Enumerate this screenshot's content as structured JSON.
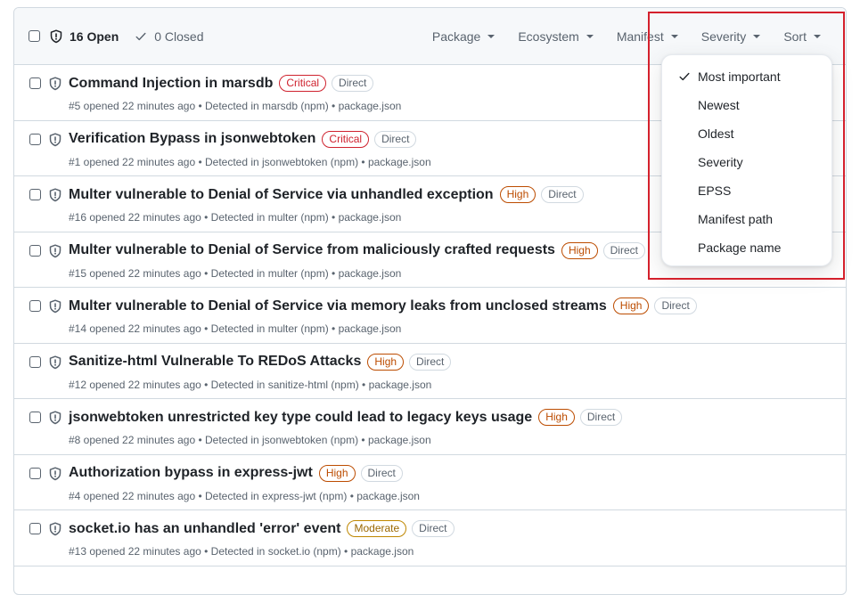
{
  "header": {
    "open_label": "16 Open",
    "closed_label": "0 Closed",
    "filters": [
      "Package",
      "Ecosystem",
      "Manifest",
      "Severity",
      "Sort"
    ]
  },
  "alerts": [
    {
      "title": "Command Injection in marsdb",
      "severity": "Critical",
      "relationship": "Direct",
      "meta": "#5 opened 22 minutes ago • Detected in marsdb (npm) • package.json"
    },
    {
      "title": "Verification Bypass in jsonwebtoken",
      "severity": "Critical",
      "relationship": "Direct",
      "meta": "#1 opened 22 minutes ago • Detected in jsonwebtoken (npm) • package.json"
    },
    {
      "title": "Multer vulnerable to Denial of Service via unhandled exception",
      "severity": "High",
      "relationship": "Direct",
      "meta": "#16 opened 22 minutes ago • Detected in multer (npm) • package.json"
    },
    {
      "title": "Multer vulnerable to Denial of Service from maliciously crafted requests",
      "severity": "High",
      "relationship": "Direct",
      "meta": "#15 opened 22 minutes ago • Detected in multer (npm) • package.json"
    },
    {
      "title": "Multer vulnerable to Denial of Service via memory leaks from unclosed streams",
      "severity": "High",
      "relationship": "Direct",
      "meta": "#14 opened 22 minutes ago • Detected in multer (npm) • package.json"
    },
    {
      "title": "Sanitize-html Vulnerable To REDoS Attacks",
      "severity": "High",
      "relationship": "Direct",
      "meta": "#12 opened 22 minutes ago • Detected in sanitize-html (npm) • package.json"
    },
    {
      "title": "jsonwebtoken unrestricted key type could lead to legacy keys usage",
      "severity": "High",
      "relationship": "Direct",
      "meta": "#8 opened 22 minutes ago • Detected in jsonwebtoken (npm) • package.json"
    },
    {
      "title": "Authorization bypass in express-jwt",
      "severity": "High",
      "relationship": "Direct",
      "meta": "#4 opened 22 minutes ago • Detected in express-jwt (npm) • package.json"
    },
    {
      "title": "socket.io has an unhandled 'error' event",
      "severity": "Moderate",
      "relationship": "Direct",
      "meta": "#13 opened 22 minutes ago • Detected in socket.io (npm) • package.json"
    }
  ],
  "sort_menu": {
    "selected": "Most important",
    "items": [
      "Most important",
      "Newest",
      "Oldest",
      "Severity",
      "EPSS",
      "Manifest path",
      "Package name"
    ]
  },
  "colors": {
    "critical": "#cf222e",
    "high": "#bc4c00",
    "moderate": "#9a6700",
    "highlight": "#d4202c"
  }
}
